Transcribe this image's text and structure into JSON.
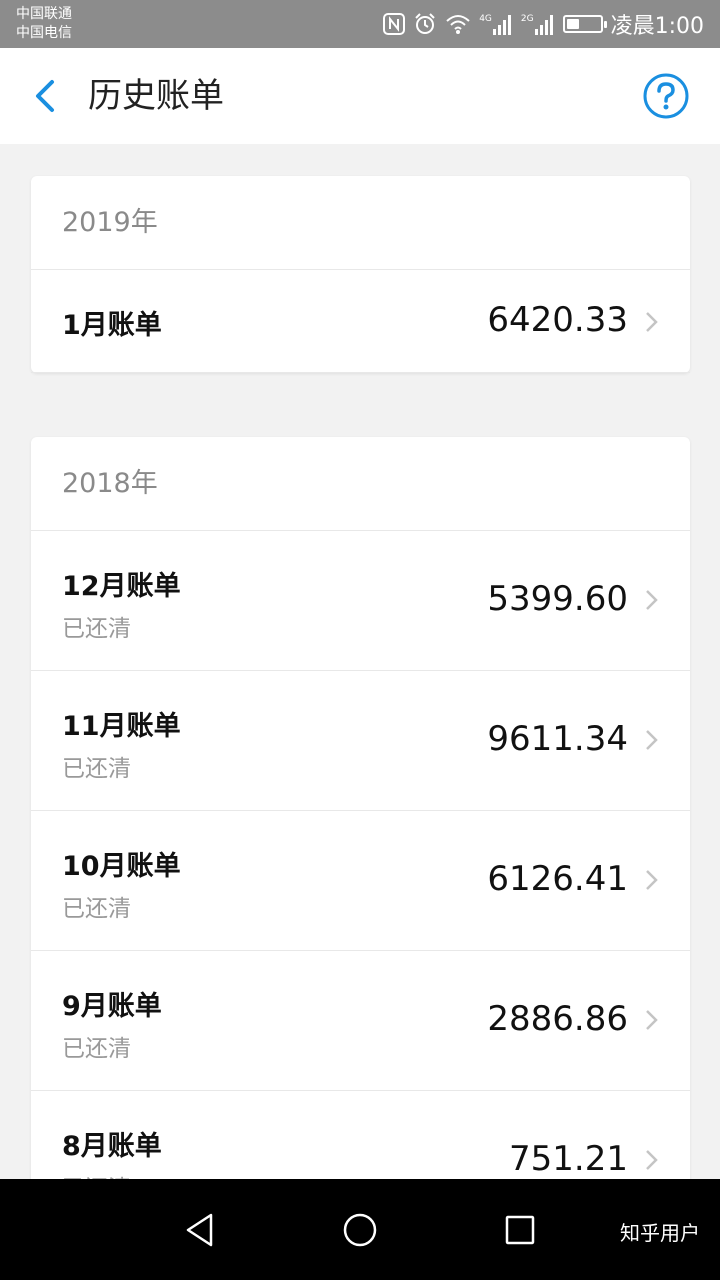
{
  "status_bar": {
    "carrier_1": "中国联通",
    "carrier_2": "中国电信",
    "signal_1_tag": "4G",
    "signal_2_tag": "2G",
    "battery_level": 0.35,
    "time": "凌晨1:00",
    "icons": [
      "nfc-icon",
      "alarm-icon",
      "wifi-icon",
      "signal-icon",
      "signal-icon",
      "battery-icon"
    ]
  },
  "header": {
    "back_icon": "back-arrow-icon",
    "title": "历史账单",
    "help_icon": "help-icon"
  },
  "sections": [
    {
      "year": "2019年",
      "bills": [
        {
          "month": "1月账单",
          "status": "",
          "amount": "6420.33"
        }
      ]
    },
    {
      "year": "2018年",
      "bills": [
        {
          "month": "12月账单",
          "status": "已还清",
          "amount": "5399.60"
        },
        {
          "month": "11月账单",
          "status": "已还清",
          "amount": "9611.34"
        },
        {
          "month": "10月账单",
          "status": "已还清",
          "amount": "6126.41"
        },
        {
          "month": "9月账单",
          "status": "已还清",
          "amount": "2886.86"
        },
        {
          "month": "8月账单",
          "status": "已还清",
          "amount": "751.21"
        }
      ]
    }
  ],
  "nav_bar": {
    "buttons": [
      "nav-back-icon",
      "nav-home-icon",
      "nav-recents-icon"
    ],
    "watermark": "知乎用户"
  },
  "colors": {
    "accent": "#1a8fe0",
    "status_bar": "#8c8c8c",
    "background": "#f2f2f2"
  }
}
